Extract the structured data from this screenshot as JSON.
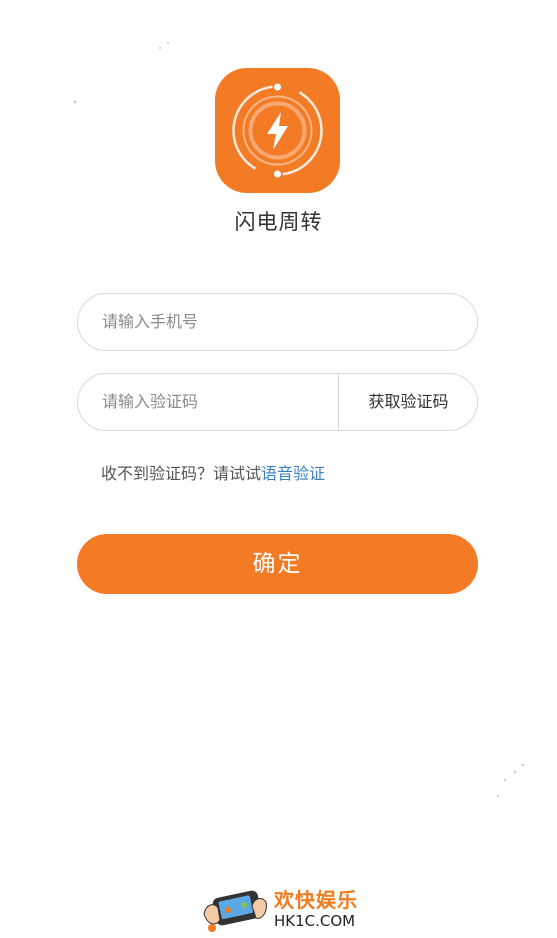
{
  "app": {
    "name": "闪电周转",
    "icon": "lightning-bolt-icon",
    "brand_color": "#f47b26"
  },
  "form": {
    "phone_placeholder": "请输入手机号",
    "code_placeholder": "请输入验证码",
    "get_code_label": "获取验证码"
  },
  "hint": {
    "text": "收不到验证码？请试试",
    "link": "语音验证"
  },
  "confirm_label": "确定",
  "watermark": {
    "title": "欢快娱乐",
    "domain": "HK1C.COM",
    "icon": "gamepad-hands-icon"
  }
}
